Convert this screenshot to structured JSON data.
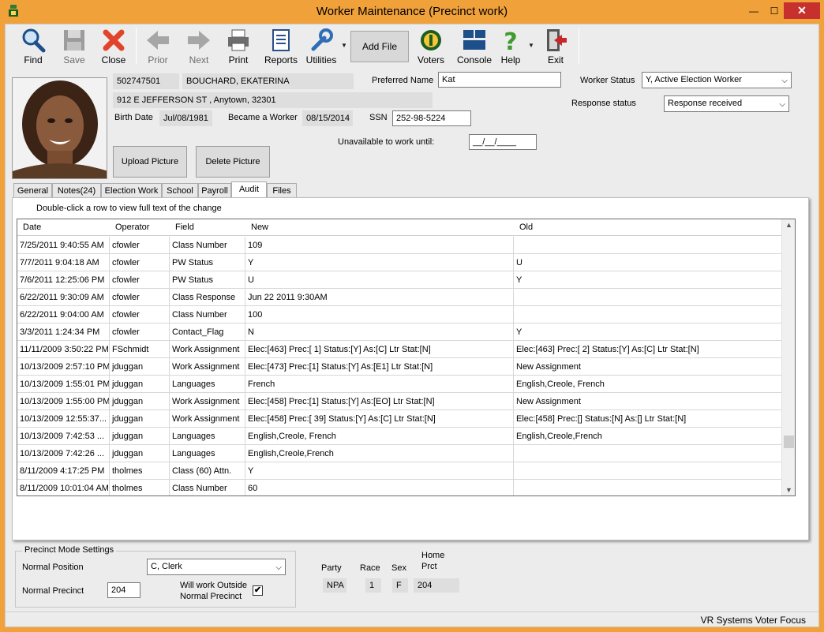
{
  "window": {
    "title": "Worker Maintenance (Precinct work)",
    "minimize": "—",
    "maximize": "☐",
    "close": "✕"
  },
  "toolbar": {
    "find": "Find",
    "save": "Save",
    "close": "Close",
    "prior": "Prior",
    "next": "Next",
    "print": "Print",
    "reports": "Reports",
    "utilities": "Utilities",
    "add_file": "Add File",
    "voters": "Voters",
    "console": "Console",
    "help": "Help",
    "exit": "Exit"
  },
  "worker": {
    "id": "502747501",
    "name": "BOUCHARD, EKATERINA",
    "address": "912 E JEFFERSON ST , Anytown, 32301",
    "birth_date_label": "Birth Date",
    "birth_date": "Jul/08/1981",
    "became_label": "Became a Worker",
    "became": "08/15/2014",
    "ssn_label": "SSN",
    "ssn": "252-98-5224",
    "preferred_label": "Preferred Name",
    "preferred": "Kat",
    "status_label": "Worker Status",
    "status": "Y, Active Election Worker",
    "response_label": "Response status",
    "response": "Response received",
    "unavailable_label": "Unavailable to work until:",
    "unavailable": "__/__/____",
    "upload_picture": "Upload Picture",
    "delete_picture": "Delete Picture"
  },
  "tabs": [
    "General",
    "Notes(24)",
    "Election Work",
    "School",
    "Payroll",
    "Audit",
    "Files"
  ],
  "audit": {
    "hint": "Double-click a row to view full text of the change",
    "headers": [
      "Date",
      "Operator",
      "Field",
      "New",
      "Old"
    ],
    "rows": [
      [
        "7/25/2011 9:40:55 AM",
        "cfowler",
        "Class Number",
        "109",
        ""
      ],
      [
        "7/7/2011 9:04:18 AM",
        "cfowler",
        "PW Status",
        "Y",
        "U"
      ],
      [
        "7/6/2011 12:25:06 PM",
        "cfowler",
        "PW Status",
        "U",
        "Y"
      ],
      [
        "6/22/2011 9:30:09 AM",
        "cfowler",
        "Class Response",
        "Jun 22 2011  9:30AM",
        ""
      ],
      [
        "6/22/2011 9:04:00 AM",
        "cfowler",
        "Class Number",
        "100",
        ""
      ],
      [
        "3/3/2011 1:24:34 PM",
        "cfowler",
        "Contact_Flag",
        "N",
        "Y"
      ],
      [
        "11/11/2009 3:50:22 PM",
        "FSchmidt",
        "Work Assignment",
        "Elec:[463] Prec:[  1] Status:[Y] As:[C] Ltr Stat:[N]",
        "Elec:[463] Prec:[  2] Status:[Y] As:[C] Ltr Stat:[N]"
      ],
      [
        "10/13/2009 2:57:10 PM",
        "jduggan",
        "Work Assignment",
        "Elec:[473] Prec:[1] Status:[Y] As:[E1] Ltr Stat:[N]",
        "New Assignment"
      ],
      [
        "10/13/2009 1:55:01 PM",
        "jduggan",
        "Languages",
        " French",
        "English,Creole, French"
      ],
      [
        "10/13/2009 1:55:00 PM",
        "jduggan",
        "Work Assignment",
        "Elec:[458] Prec:[1] Status:[Y] As:[EO] Ltr Stat:[N]",
        "New Assignment"
      ],
      [
        "10/13/2009 12:55:37...",
        "jduggan",
        "Work Assignment",
        "Elec:[458] Prec:[ 39] Status:[Y] As:[C] Ltr Stat:[N]",
        "Elec:[458] Prec:[] Status:[N] As:[] Ltr Stat:[N]"
      ],
      [
        "10/13/2009 7:42:53 ...",
        "jduggan",
        "Languages",
        "English,Creole, French",
        "English,Creole,French"
      ],
      [
        "10/13/2009 7:42:26 ...",
        "jduggan",
        "Languages",
        "English,Creole,French",
        ""
      ],
      [
        "8/11/2009 4:17:25 PM",
        "tholmes",
        "Class (60) Attn.",
        "Y",
        ""
      ],
      [
        "8/11/2009 10:01:04 AM",
        "tholmes",
        "Class Number",
        "60",
        ""
      ]
    ]
  },
  "precinct": {
    "group_title": "Precinct Mode Settings",
    "normal_position_label": "Normal Position",
    "normal_position": "C, Clerk",
    "normal_precinct_label": "Normal Precinct",
    "normal_precinct": "204",
    "outside_label_1": "Will work Outside",
    "outside_label_2": "Normal Precinct",
    "outside_checked": "✔"
  },
  "demographics": {
    "party_label": "Party",
    "party": "NPA",
    "race_label": "Race",
    "race": "1",
    "sex_label": "Sex",
    "sex": "F",
    "home_label_1": "Home",
    "home_label_2": "Prct",
    "home": "204"
  },
  "statusbar": {
    "text": "VR Systems Voter Focus"
  }
}
